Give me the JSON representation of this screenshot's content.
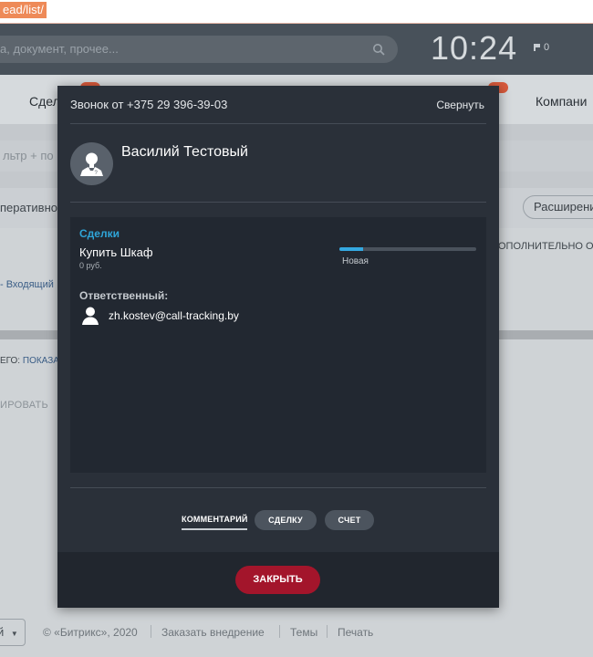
{
  "browser": {
    "url_fragment": "ead/list/"
  },
  "topbar": {
    "search_placeholder": "а, документ, прочее...",
    "clock": "10:24",
    "flag_count": "0"
  },
  "menu": {
    "item_deals": "Сдел",
    "item_companies": "Компани"
  },
  "page": {
    "filter_text": "льтр + по",
    "operative_text": "перативно",
    "advanced_button": "Расширени",
    "more_text": "ОПОЛНИТЕЛЬНО ОБ",
    "incoming_link": "- Входящий",
    "total_label": "ЕГО:",
    "total_link": "ПОКАЗА",
    "edit_label": "ИРОВАТЬ"
  },
  "footer": {
    "lang_label": "й",
    "copyright": "© «Битрикс», 2020",
    "order_link": "Заказать внедрение",
    "themes_link": "Темы",
    "print_link": "Печать"
  },
  "popup": {
    "title": "Звонок от +375 29 396-39-03",
    "collapse_label": "Свернуть",
    "caller_name": "Василий Тестовый",
    "deals_title": "Сделки",
    "deal": {
      "name": "Купить Шкаф",
      "sum": "0 руб.",
      "stage": "Новая",
      "progress": 0.17
    },
    "responsible_title": "Ответственный:",
    "responsible_email": "zh.kostev@call-tracking.by",
    "actions": {
      "comment": "КОММЕНТАРИЙ",
      "deal": "СДЕЛКУ",
      "invoice": "СЧЕТ"
    },
    "close_label": "ЗАКРЫТЬ"
  },
  "colors": {
    "accent_blue": "#2fa5d8",
    "close_red": "#a3152b",
    "popup_bg": "#2a3039"
  }
}
